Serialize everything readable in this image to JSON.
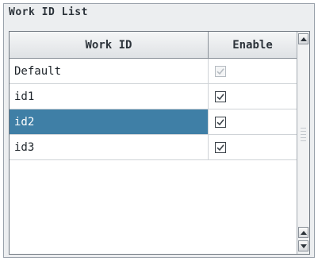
{
  "group": {
    "title": "Work ID List"
  },
  "table": {
    "columns": [
      "Work ID",
      "Enable"
    ],
    "rows": [
      {
        "work_id": "Default",
        "enabled": true,
        "disabled": true,
        "selected": false
      },
      {
        "work_id": "id1",
        "enabled": true,
        "disabled": false,
        "selected": false
      },
      {
        "work_id": "id2",
        "enabled": true,
        "disabled": false,
        "selected": true
      },
      {
        "work_id": "id3",
        "enabled": true,
        "disabled": false,
        "selected": false
      }
    ]
  },
  "colors": {
    "selection": "#3f7fa6",
    "panel_bg": "#eceef0",
    "checkbox_border": "#3a4148",
    "checkbox_disabled": "#b6bcc2"
  },
  "icons": {
    "checkbox": "checkbox-checked-icon",
    "scroll_up": "arrow-up-icon",
    "scroll_down": "arrow-down-icon"
  }
}
